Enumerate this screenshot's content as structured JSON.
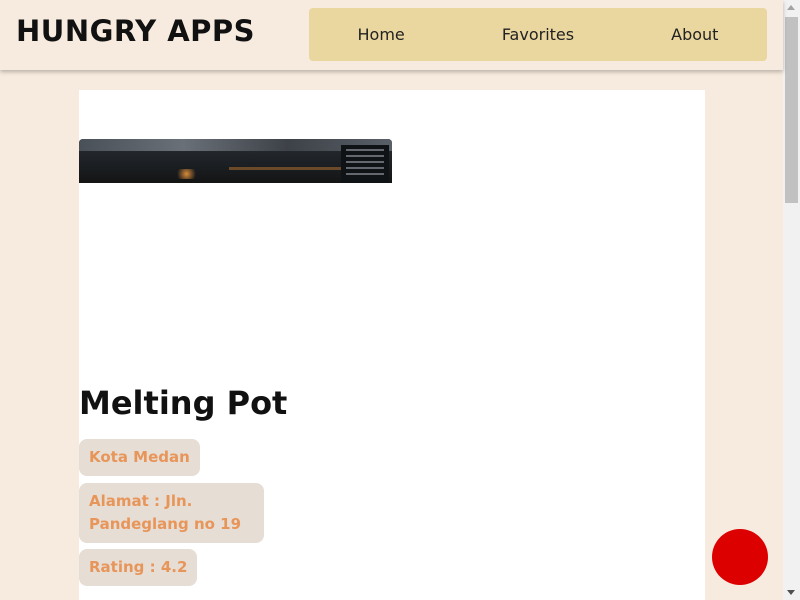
{
  "header": {
    "brand": "HUNGRY APPS",
    "nav": [
      {
        "label": "Home"
      },
      {
        "label": "Favorites"
      },
      {
        "label": "About"
      }
    ]
  },
  "restaurant": {
    "image_icon": "restaurant-interior-image",
    "name": "Melting Pot",
    "city": "Kota Medan",
    "address": "Alamat : Jln. Pandeglang no 19",
    "rating": "Rating : 4.2"
  },
  "favorite_button": {
    "icon": "favorite-button-icon",
    "color": "#dd0000"
  },
  "colors": {
    "background": "#f7ebdf",
    "nav_background": "#ead69f",
    "chip_background": "#e6ddd4",
    "chip_text": "#e8955a"
  }
}
